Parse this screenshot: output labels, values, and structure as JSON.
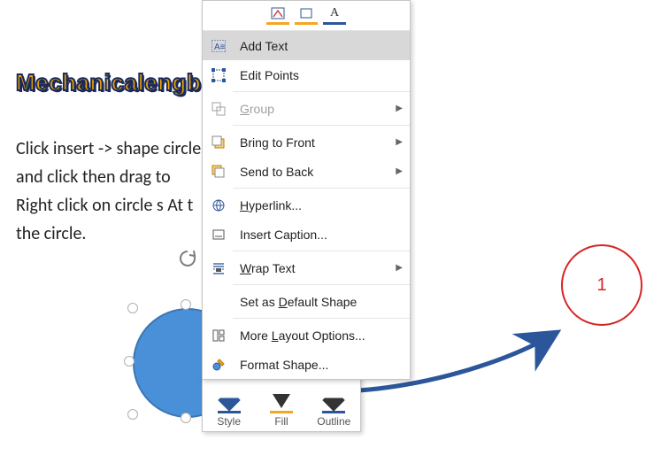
{
  "watermark": "Mechanicalengblog.com",
  "body_lines": [
    "Click insert -> shape                                          circle",
    "and click then drag to",
    "Right click on circle s                                               At t",
    "the circle."
  ],
  "menu": {
    "items": [
      {
        "label": "Add Text",
        "ukey": "",
        "icon": "add-text-icon",
        "arrow": false,
        "highlight": true,
        "disabled": false
      },
      {
        "label": "Edit Points",
        "ukey": "",
        "icon": "edit-points-icon",
        "arrow": false,
        "highlight": false,
        "disabled": false
      },
      {
        "sep": true
      },
      {
        "label": "Group",
        "ukey": "G",
        "icon": "group-icon",
        "arrow": true,
        "highlight": false,
        "disabled": true
      },
      {
        "sep": true
      },
      {
        "label": "Bring to Front",
        "ukey": "R",
        "icon": "bring-front-icon",
        "arrow": true,
        "highlight": false,
        "disabled": false
      },
      {
        "label": "Send to Back",
        "ukey": "K",
        "icon": "send-back-icon",
        "arrow": true,
        "highlight": false,
        "disabled": false
      },
      {
        "sep": true
      },
      {
        "label": "Hyperlink...",
        "ukey": "H",
        "icon": "hyperlink-icon",
        "arrow": false,
        "highlight": false,
        "disabled": false
      },
      {
        "label": "Insert Caption...",
        "ukey": "",
        "icon": "caption-icon",
        "arrow": false,
        "highlight": false,
        "disabled": false
      },
      {
        "sep": true
      },
      {
        "label": "Wrap Text",
        "ukey": "W",
        "icon": "wrap-text-icon",
        "arrow": true,
        "highlight": false,
        "disabled": false
      },
      {
        "sep": true
      },
      {
        "label": "Set as Default Shape",
        "ukey": "D",
        "icon": "",
        "arrow": false,
        "highlight": false,
        "disabled": false
      },
      {
        "sep": true
      },
      {
        "label": "More Layout Options...",
        "ukey": "L",
        "icon": "layout-options-icon",
        "arrow": false,
        "highlight": false,
        "disabled": false
      },
      {
        "label": "Format Shape...",
        "ukey": "",
        "icon": "format-shape-icon",
        "arrow": false,
        "highlight": false,
        "disabled": false
      }
    ]
  },
  "minibar": {
    "style": "Style",
    "fill": "Fill",
    "outline": "Outline"
  },
  "result": {
    "label": "1"
  }
}
